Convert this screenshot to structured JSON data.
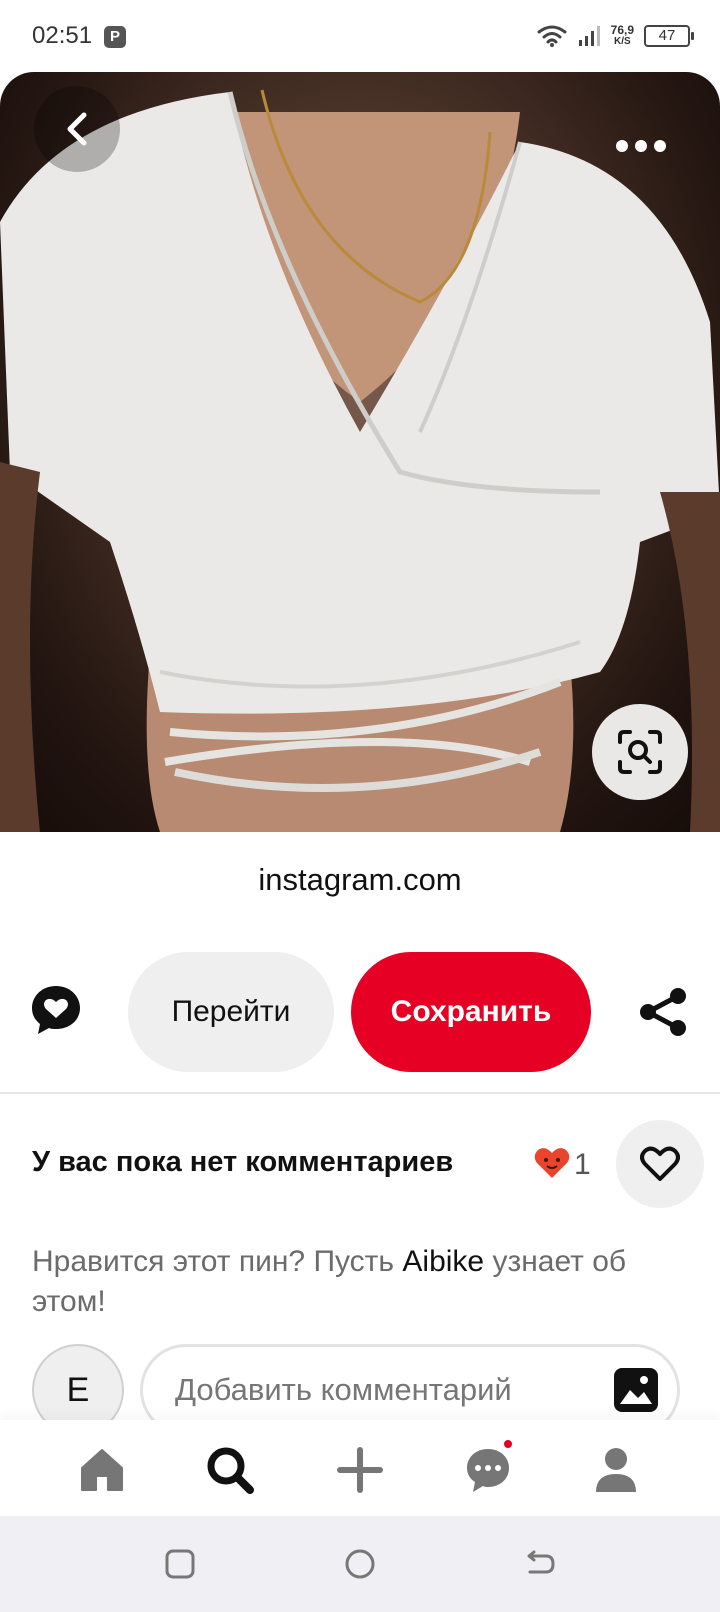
{
  "status_bar": {
    "time": "02:51",
    "app_icon": "P",
    "net_speed_value": "76,9",
    "net_speed_unit": "K/S",
    "battery": "47"
  },
  "pin": {
    "source": "instagram.com"
  },
  "actions": {
    "visit_label": "Перейти",
    "save_label": "Сохранить"
  },
  "comments": {
    "title": "У вас пока нет комментариев",
    "reaction_count": "1",
    "hint_before": "Нравится этот пин? Пусть ",
    "hint_user": "Aibike",
    "hint_after": " узнает об этом!",
    "avatar_initial": "E",
    "input_placeholder": "Добавить комментарий"
  },
  "bottom_nav": [
    "home-icon",
    "search-icon",
    "create-icon",
    "messages-icon",
    "profile-icon"
  ],
  "colors": {
    "accent": "#e60023",
    "button_gray": "#efefef",
    "reaction": "#e8452c"
  }
}
